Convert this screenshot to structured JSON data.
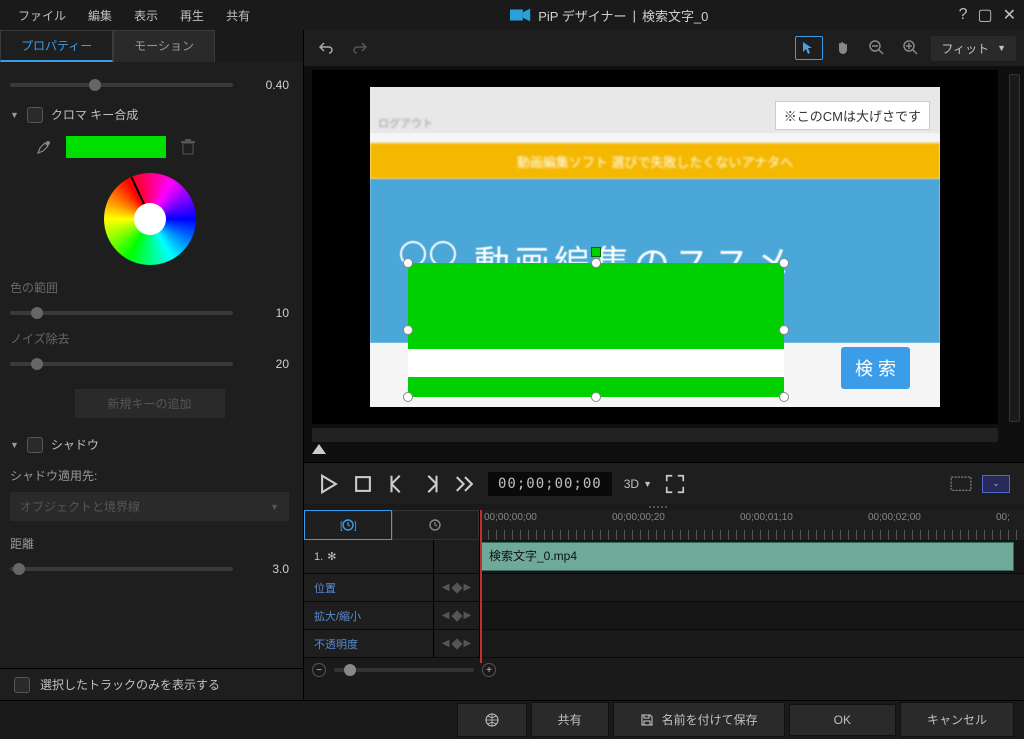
{
  "title": {
    "app": "PiP デザイナー",
    "sep": "|",
    "doc": "検索文字_0"
  },
  "menu": [
    "ファイル",
    "編集",
    "表示",
    "再生",
    "共有"
  ],
  "tabs": {
    "property": "プロパティー",
    "motion": "モーション"
  },
  "props": {
    "top_value": "0.40",
    "chroma_title": "クロマ キー合成",
    "color_range": "色の範囲",
    "color_range_val": "10",
    "noise": "ノイズ除去",
    "noise_val": "20",
    "add_key": "新規キーの追加",
    "shadow_title": "シャドウ",
    "shadow_target_label": "シャドウ適用先:",
    "shadow_target_value": "オブジェクトと境界線",
    "distance_label": "距離",
    "distance_val": "3.0"
  },
  "preview": {
    "note": "※このCMは大げさです",
    "top_text": "ログアウト",
    "band_text": "動画編集ソフト 選びで失敗したくないアナタへ",
    "blue_text": "動画編集のススメ",
    "search": "検 索",
    "fit": "フィット"
  },
  "playback": {
    "timecode": "00;00;00;00",
    "mode3d": "3D"
  },
  "ruler": [
    "00;00;00;00",
    "00;00;00;20",
    "00;00;01;10",
    "00;00;02;00",
    "00;"
  ],
  "tracks": {
    "main_idx": "1.",
    "clip": "検索文字_0.mp4",
    "rows": [
      "位置",
      "拡大/縮小",
      "不透明度"
    ]
  },
  "bottom_cb": "選択したトラックのみを表示する",
  "footer": {
    "share": "共有",
    "saveas": "名前を付けて保存",
    "ok": "OK",
    "cancel": "キャンセル"
  }
}
